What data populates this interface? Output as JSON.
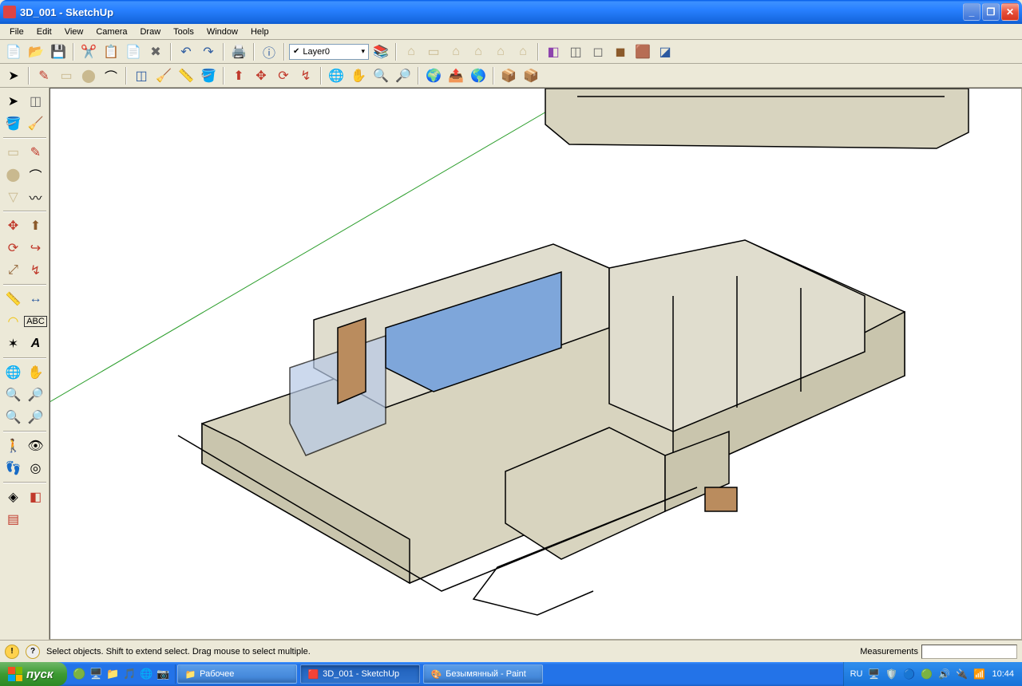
{
  "window": {
    "title": "3D_001 - SketchUp"
  },
  "menu": {
    "file": "File",
    "edit": "Edit",
    "view": "View",
    "camera": "Camera",
    "draw": "Draw",
    "tools": "Tools",
    "window": "Window",
    "help": "Help"
  },
  "layer": {
    "current": "Layer0"
  },
  "status": {
    "hint": "Select objects. Shift to extend select. Drag mouse to select multiple.",
    "measurements_label": "Measurements"
  },
  "taskbar": {
    "start": "пуск",
    "tasks": [
      {
        "label": "Рабочее"
      },
      {
        "label": "3D_001 - SketchUp"
      },
      {
        "label": "Безымянный - Paint"
      }
    ],
    "lang": "RU",
    "clock": "10:44"
  }
}
